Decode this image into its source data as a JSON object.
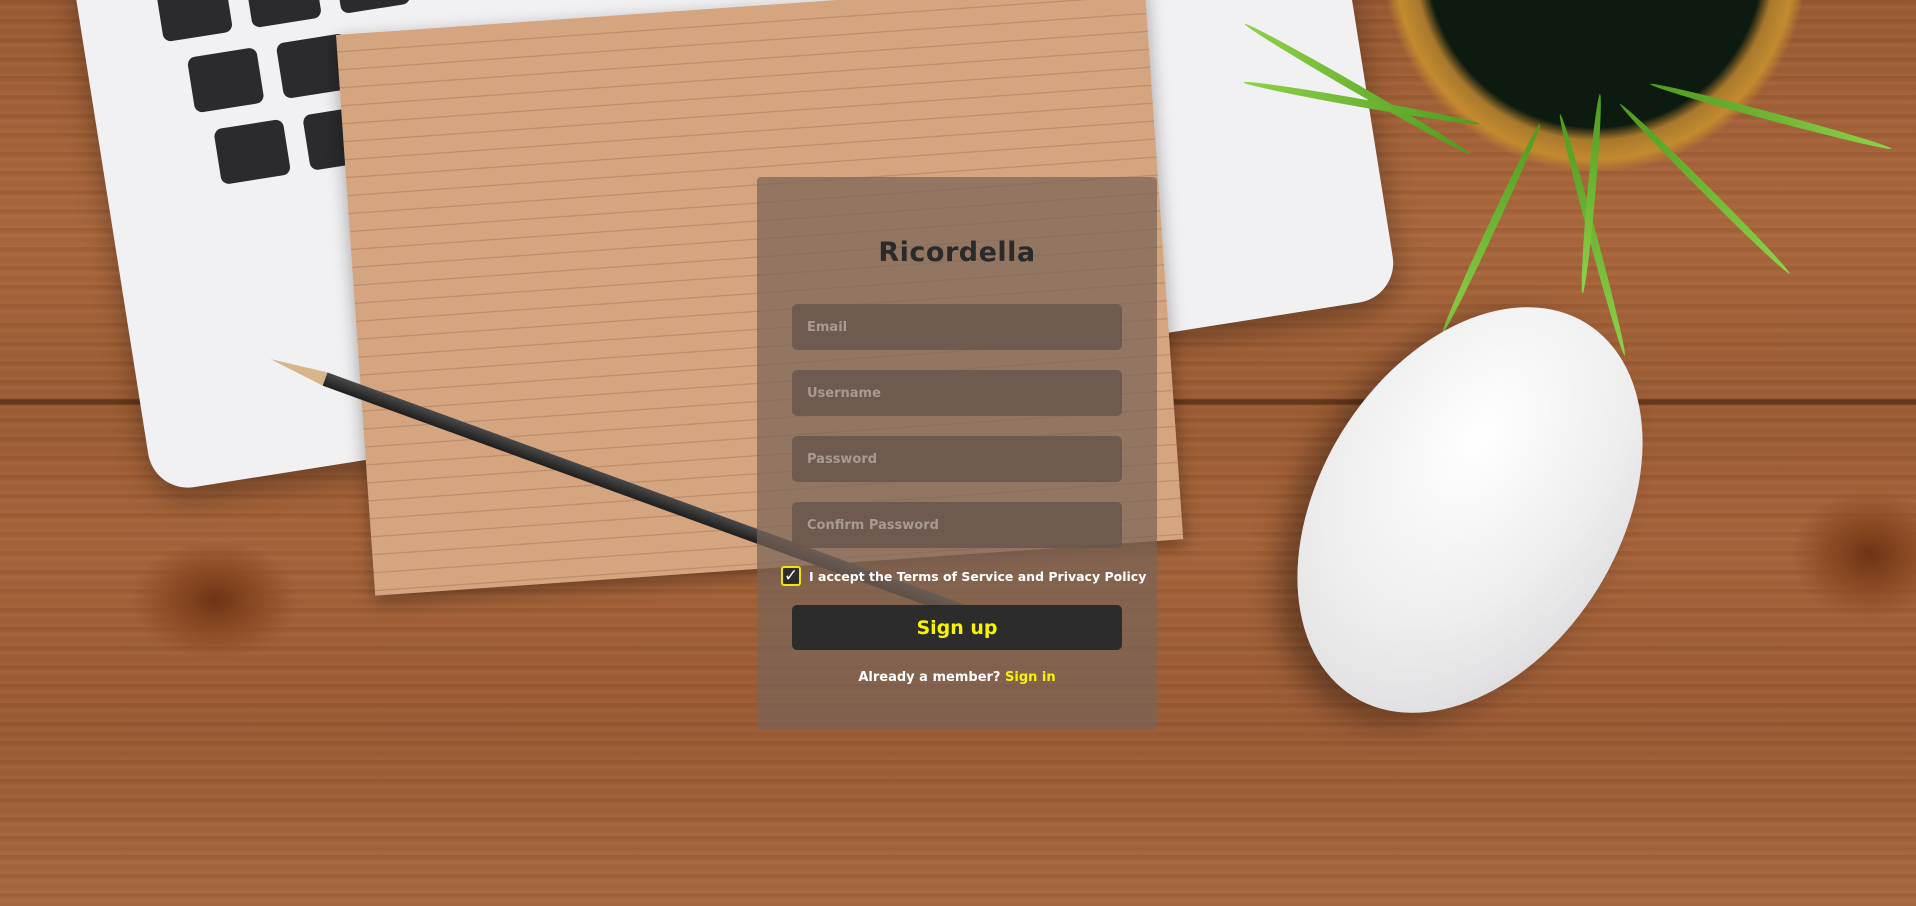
{
  "brand": {
    "name": "Ricordella",
    "accent_color": "#f5f500",
    "button_color": "#2c2c2c"
  },
  "form": {
    "email_placeholder": "Email",
    "username_placeholder": "Username",
    "password_placeholder": "Password",
    "confirm_password_placeholder": "Confirm Password",
    "terms_checked": true,
    "terms_check_glyph": "✓",
    "terms_label": "I accept the Terms of Service and Privacy Policy",
    "submit_label": "Sign up"
  },
  "footer": {
    "member_prompt": "Already a member?",
    "signin_label": "Sign in"
  },
  "background": {
    "scene": [
      "laptop",
      "notepad",
      "pencil",
      "potted-plant",
      "mouse",
      "wooden-desk"
    ]
  }
}
